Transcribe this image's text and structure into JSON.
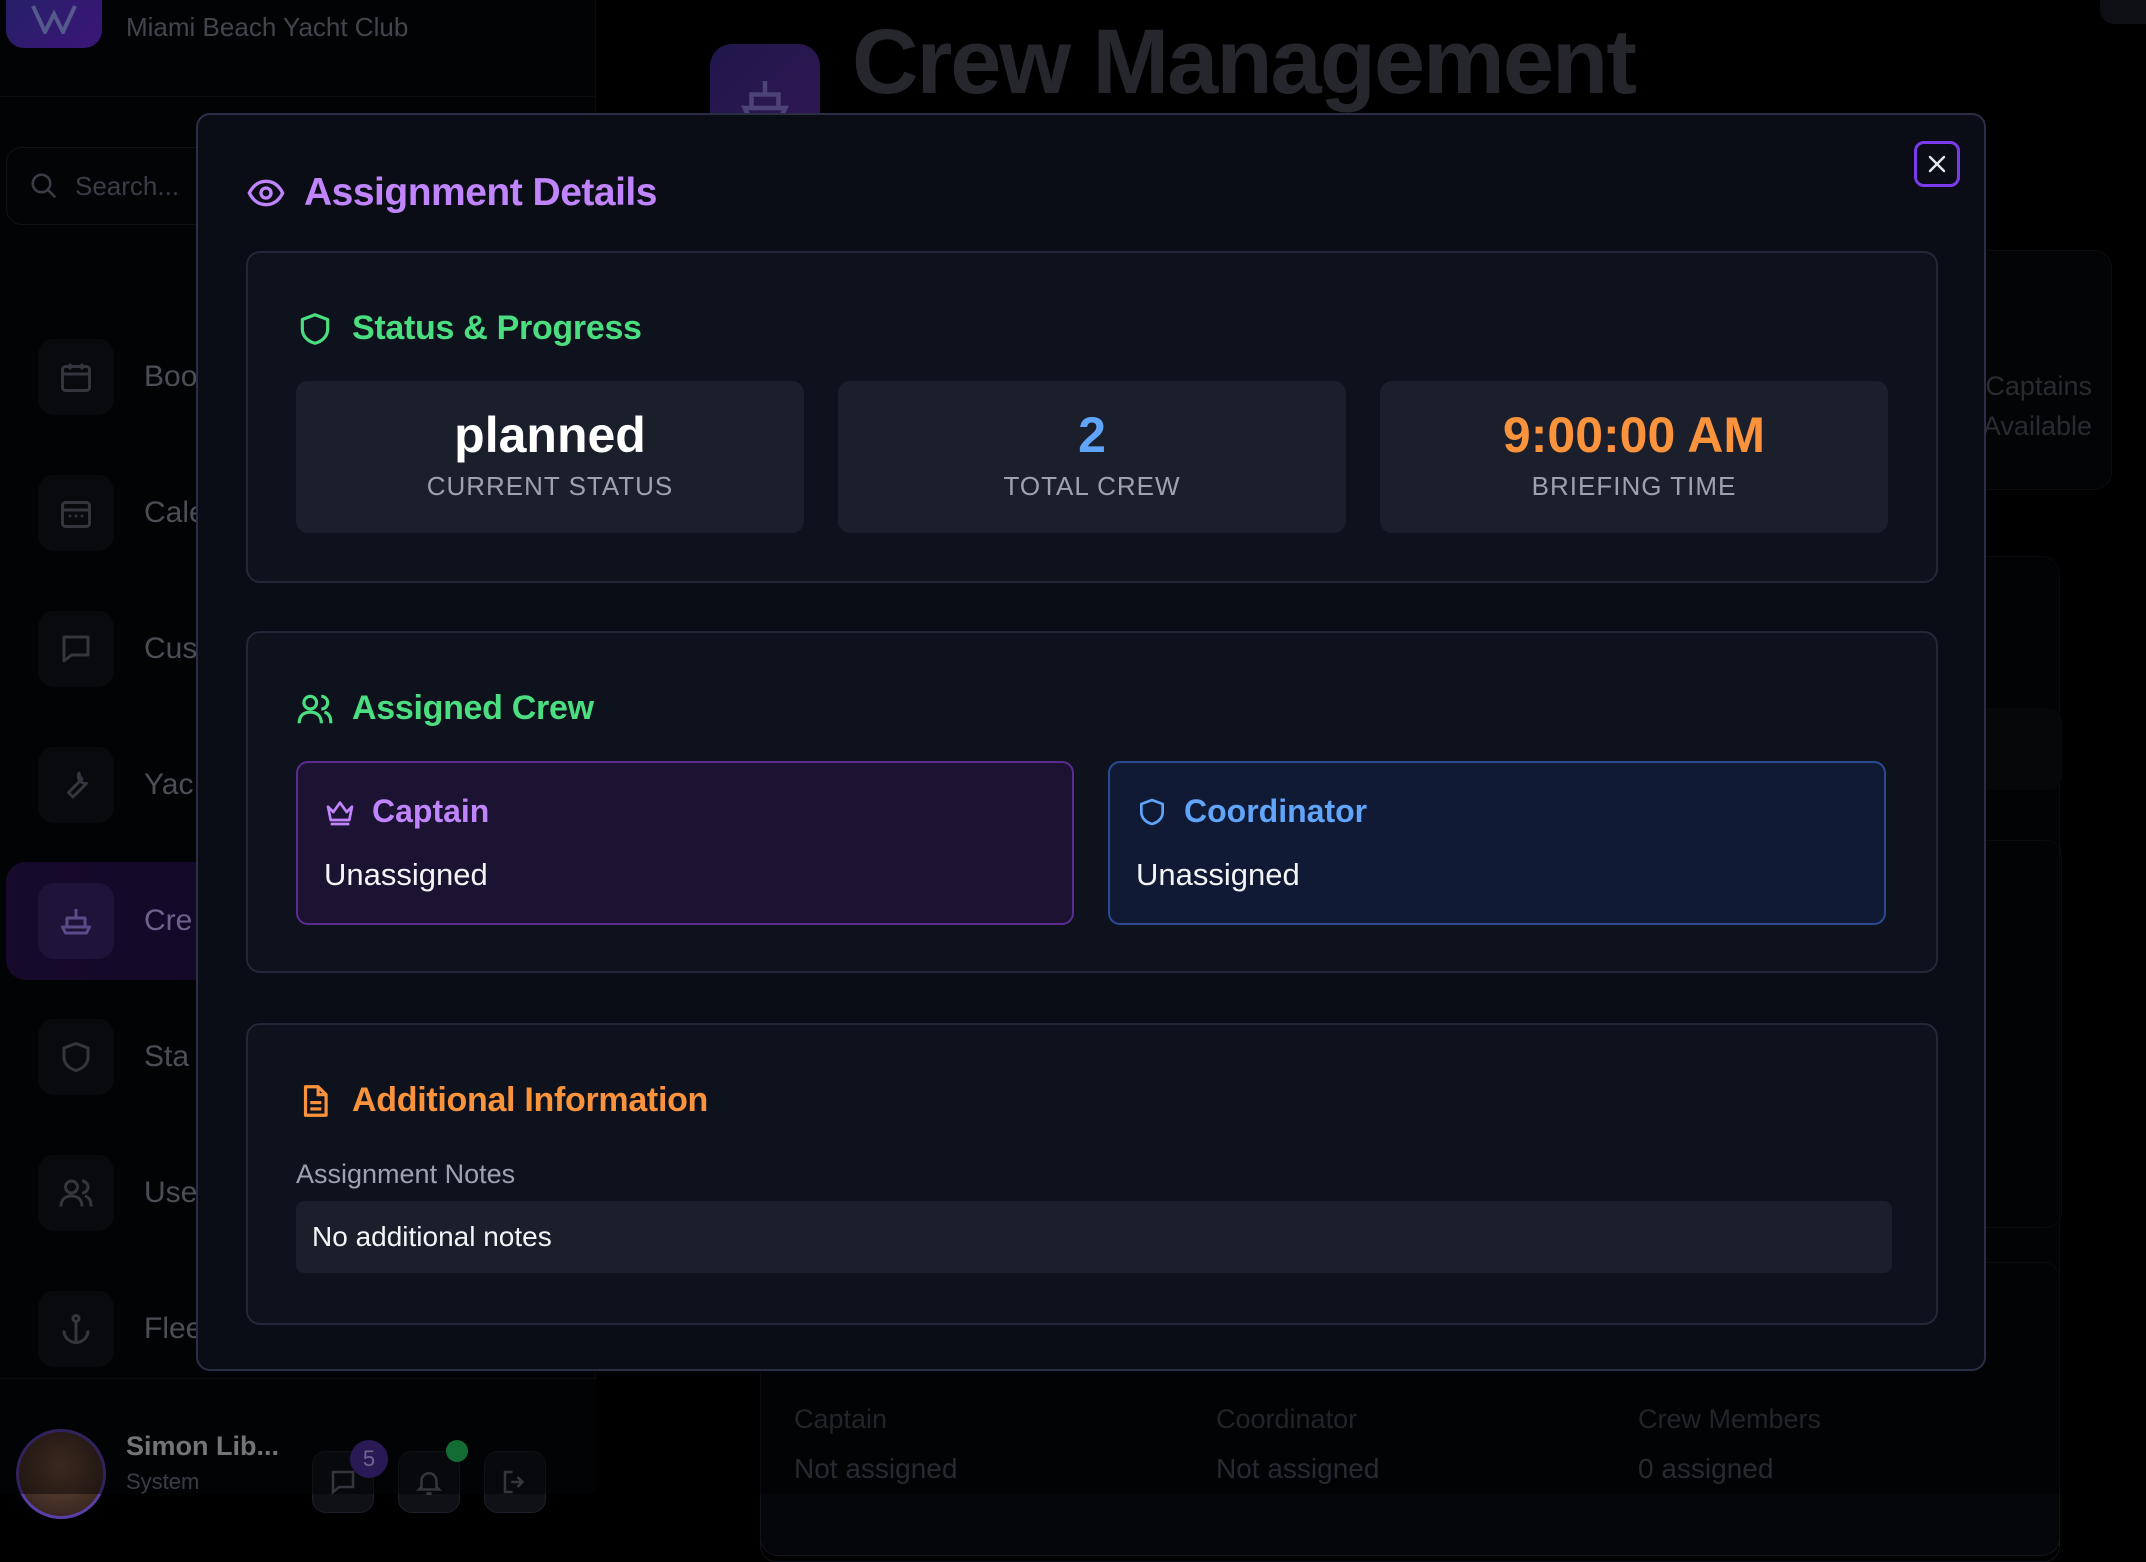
{
  "app": {
    "brand_subtitle": "Miami Beach Yacht Club",
    "search_placeholder": "Search...",
    "page_title": "Crew Management",
    "stat_lines": [
      "Captains",
      "Available"
    ],
    "nav_items": [
      {
        "label": "Boo",
        "icon": "calendar-icon"
      },
      {
        "label": "Cale",
        "icon": "calendar-icon"
      },
      {
        "label": "Cus",
        "icon": "message-icon"
      },
      {
        "label": "Yac",
        "icon": "wrench-icon"
      },
      {
        "label": "Cre",
        "icon": "ship-icon",
        "active": true
      },
      {
        "label": "Sta",
        "icon": "shield-icon"
      },
      {
        "label": "Use",
        "icon": "users-icon"
      },
      {
        "label": "Flee",
        "icon": "anchor-icon"
      }
    ],
    "user": {
      "name": "Simon Lib...",
      "role": "System",
      "message_count": "5"
    },
    "bg_columns": [
      {
        "label": "Captain",
        "value": "Not assigned"
      },
      {
        "label": "Coordinator",
        "value": "Not assigned"
      },
      {
        "label": "Crew Members",
        "value": "0 assigned"
      }
    ]
  },
  "modal": {
    "title": "Assignment Details",
    "status_section": {
      "title": "Status & Progress",
      "stats": [
        {
          "value": "planned",
          "label": "Current Status",
          "color": "#ffffff"
        },
        {
          "value": "2",
          "label": "Total Crew",
          "color": "#60a5fa"
        },
        {
          "value": "9:00:00 AM",
          "label": "Briefing Time",
          "color": "#fb923c"
        }
      ]
    },
    "crew_section": {
      "title": "Assigned Crew",
      "captain": {
        "role": "Captain",
        "name": "Unassigned",
        "color": "#c084fc"
      },
      "coordinator": {
        "role": "Coordinator",
        "name": "Unassigned",
        "color": "#60a5fa"
      }
    },
    "info_section": {
      "title": "Additional Information",
      "notes_label": "Assignment Notes",
      "notes_value": "No additional notes"
    }
  },
  "colors": {
    "accent_purple": "#c084fc",
    "accent_green": "#4ade80",
    "accent_orange": "#fb923c",
    "accent_blue": "#60a5fa"
  }
}
